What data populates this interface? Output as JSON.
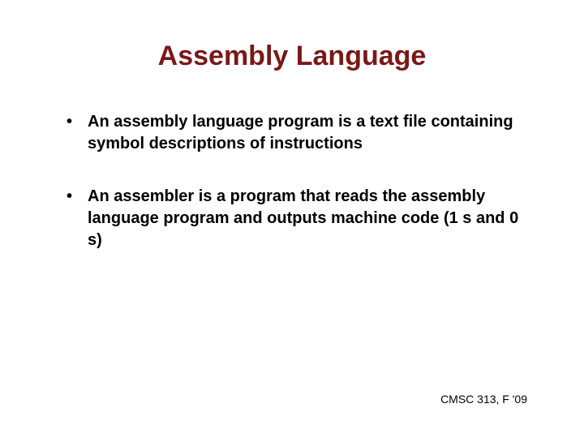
{
  "slide": {
    "title": "Assembly Language",
    "bullets": [
      "An assembly language program is a text file containing symbol descriptions of instructions",
      " An assembler is a program that reads the assembly language program  and outputs machine code (1 s and 0 s)"
    ],
    "footer": "CMSC 313, F '09"
  }
}
